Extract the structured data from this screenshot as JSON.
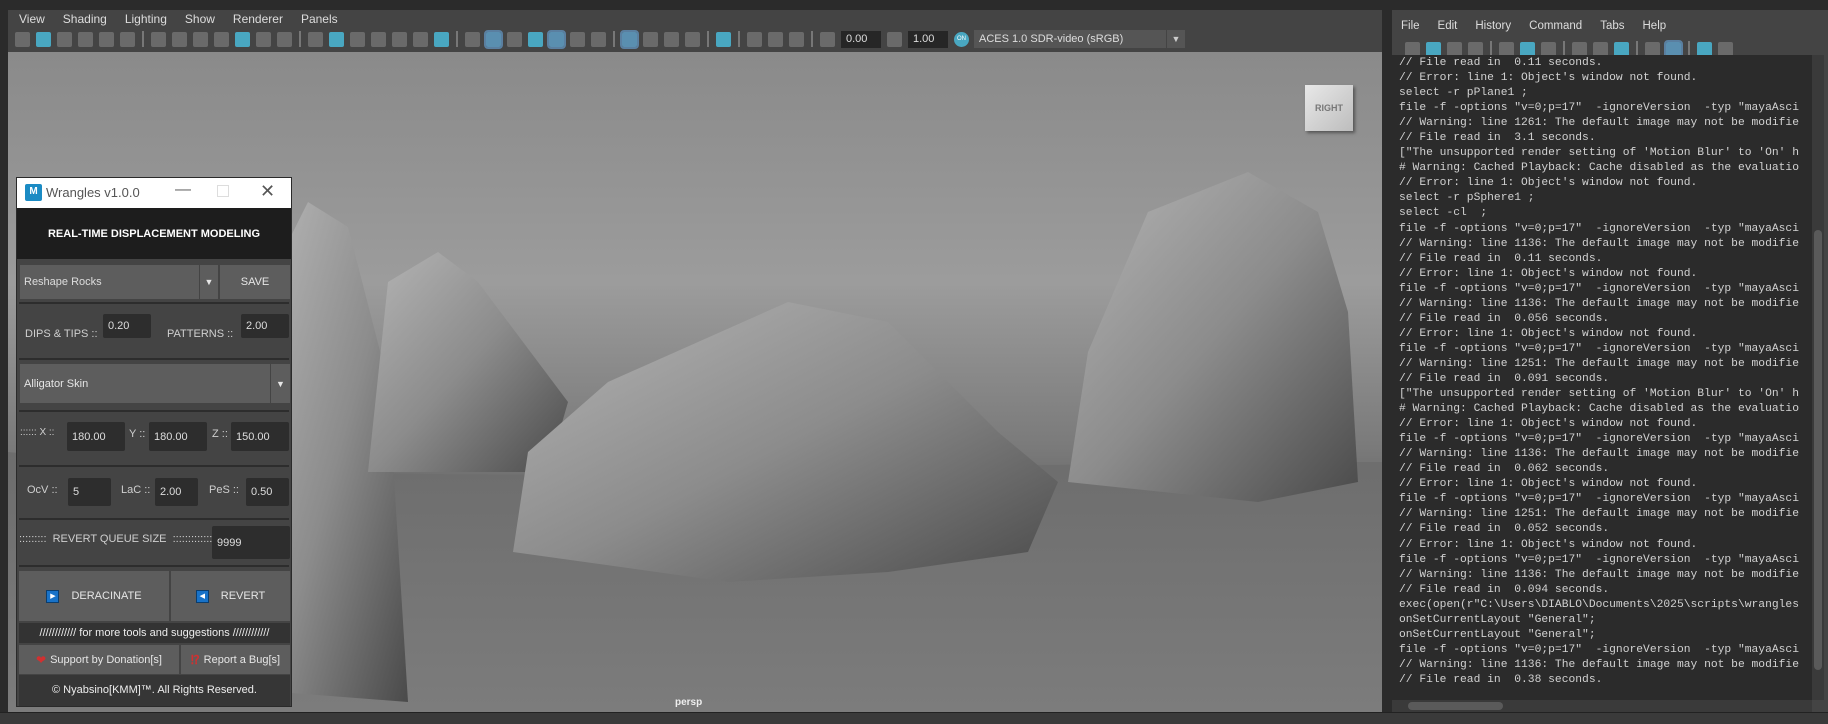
{
  "viewport_panel": {
    "menu": [
      "View",
      "Shading",
      "Lighting",
      "Show",
      "Renderer",
      "Panels"
    ],
    "toolbar_icons": [
      "select-camera-icon",
      "camera-attributes-icon",
      "bookmarks-icon",
      "image-plane-icon",
      "2d-pan-zoom-icon",
      "grease-pencil-icon",
      "|",
      "camera-icon",
      "lock-camera-icon",
      "camera-snapshot-icon",
      "bookmark-icon",
      "ruler-icon",
      "pan-zoom-icon",
      "pencil-icon",
      "|",
      "grid-icon",
      "film-gate-icon",
      "resolution-gate-icon",
      "gate-mask-icon",
      "field-chart-icon",
      "safe-action-icon",
      "safe-title-icon",
      "|",
      "wireframe-icon",
      "smooth-shade-icon",
      "default-material-icon",
      "wireframe-on-shaded-icon",
      "textured-icon",
      "use-all-lights-icon",
      "shadows-icon",
      "|",
      "screen-space-ao-icon",
      "motion-blur-icon",
      "multisample-aa-icon",
      "depth-of-field-icon",
      "|",
      "isolate-select-icon",
      "|",
      "xray-icon",
      "xray-joints-icon",
      "backface-culling-icon",
      "|",
      "exposure-icon"
    ],
    "exposure": "0.00",
    "gamma": "1.00",
    "color_mgmt_toggle": "ON",
    "view_transform": "ACES 1.0 SDR-video (sRGB)",
    "viewcube_label": "RIGHT",
    "camera_label": "persp"
  },
  "wrangles": {
    "title": "Wrangles v1.0.0",
    "header": "REAL-TIME DISPLACEMENT MODELING",
    "preset": "Reshape Rocks",
    "save": "SAVE",
    "dips_label": "DIPS & TIPS ::",
    "dips_value": "0.20",
    "patterns_label": "PATTERNS ::",
    "patterns_value": "2.00",
    "pattern_type": "Alligator Skin",
    "x_label": ":::::: X ::",
    "x_value": "180.00",
    "y_label": "Y ::",
    "y_value": "180.00",
    "z_label": "Z ::",
    "z_value": "150.00",
    "ocv_label": "OcV ::",
    "ocv_value": "5",
    "lac_label": "LaC ::",
    "lac_value": "2.00",
    "pes_label": "PeS ::",
    "pes_value": "0.50",
    "queue_label": ":::::::::  REVERT QUEUE SIZE  ::::::::::::::",
    "queue_value": "9999",
    "deracinate": "DERACINATE",
    "revert": "REVERT",
    "info": "//////////// for more tools and suggestions ////////////",
    "donate": "Support by Donation[s]",
    "bug": "Report a Bug[s]",
    "footer": "© Nyabsino[KMM]™. All Rights Reserved."
  },
  "script_editor": {
    "menu": [
      "File",
      "Edit",
      "History",
      "Command",
      "Tabs",
      "Help"
    ],
    "toolbar_icons": [
      "load-script-icon",
      "source-script-icon",
      "save-script-icon",
      "save-to-shelf-icon",
      "|",
      "clear-history-icon",
      "clear-input-icon",
      "clear-all-icon",
      "|",
      "show-history-icon",
      "show-input-icon",
      "show-both-icon",
      "|",
      "echo-all-commands-icon",
      "line-numbers-icon",
      "|",
      "execute-all-icon",
      "execute-icon"
    ],
    "log": [
      "// File read in  0.11 seconds.",
      "// Error: line 1: Object's window not found.",
      "select -r pPlane1 ;",
      "file -f -options \"v=0;p=17\"  -ignoreVersion  -typ \"mayaAsci",
      "// Warning: line 1261: The default image may not be modifie",
      "// File read in  3.1 seconds.",
      "[\"The unsupported render setting of 'Motion Blur' to 'On' h",
      "# Warning: Cached Playback: Cache disabled as the evaluatio",
      "// Error: line 1: Object's window not found.",
      "select -r pSphere1 ;",
      "select -cl  ;",
      "file -f -options \"v=0;p=17\"  -ignoreVersion  -typ \"mayaAsci",
      "// Warning: line 1136: The default image may not be modifie",
      "// File read in  0.11 seconds.",
      "// Error: line 1: Object's window not found.",
      "file -f -options \"v=0;p=17\"  -ignoreVersion  -typ \"mayaAsci",
      "// Warning: line 1136: The default image may not be modifie",
      "// File read in  0.056 seconds.",
      "// Error: line 1: Object's window not found.",
      "file -f -options \"v=0;p=17\"  -ignoreVersion  -typ \"mayaAsci",
      "// Warning: line 1251: The default image may not be modifie",
      "// File read in  0.091 seconds.",
      "[\"The unsupported render setting of 'Motion Blur' to 'On' h",
      "# Warning: Cached Playback: Cache disabled as the evaluatio",
      "// Error: line 1: Object's window not found.",
      "file -f -options \"v=0;p=17\"  -ignoreVersion  -typ \"mayaAsci",
      "// Warning: line 1136: The default image may not be modifie",
      "// File read in  0.062 seconds.",
      "// Error: line 1: Object's window not found.",
      "file -f -options \"v=0;p=17\"  -ignoreVersion  -typ \"mayaAsci",
      "// Warning: line 1251: The default image may not be modifie",
      "// File read in  0.052 seconds.",
      "// Error: line 1: Object's window not found.",
      "file -f -options \"v=0;p=17\"  -ignoreVersion  -typ \"mayaAsci",
      "// Warning: line 1136: The default image may not be modifie",
      "// File read in  0.094 seconds.",
      "exec(open(r\"C:\\Users\\DIABLO\\Documents\\2025\\scripts\\wrangles",
      "onSetCurrentLayout \"General\";",
      "onSetCurrentLayout \"General\";",
      "file -f -options \"v=0;p=17\"  -ignoreVersion  -typ \"mayaAsci",
      "// Warning: line 1136: The default image may not be modifie",
      "// File read in  0.38 seconds."
    ]
  }
}
